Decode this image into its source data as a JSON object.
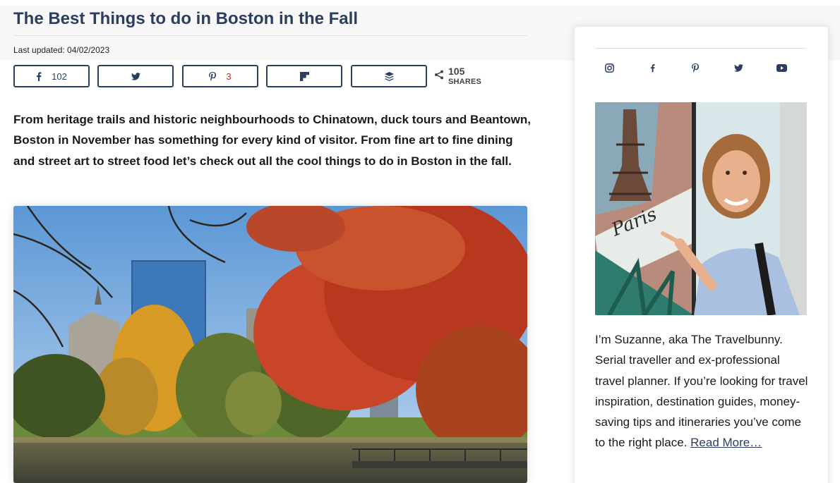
{
  "article": {
    "title": "The Best Things to do in Boston in the Fall",
    "last_updated": "Last updated: 04/02/2023",
    "intro": "From heritage trails and historic neighbourhoods to Chinatown, duck tours and Beantown, Boston in November has something for every kind of visitor. From fine art to fine dining and street art to street food let’s check out all the cool things to do in Boston in the fall."
  },
  "share": {
    "buttons": [
      {
        "icon": "facebook-icon",
        "count": "102"
      },
      {
        "icon": "twitter-icon",
        "count": ""
      },
      {
        "icon": "pinterest-icon",
        "count": "3"
      },
      {
        "icon": "flipboard-icon",
        "count": ""
      },
      {
        "icon": "buffer-icon",
        "count": ""
      }
    ],
    "total": "105",
    "total_label": "SHARES"
  },
  "sidebar": {
    "social_icons": [
      "instagram-icon",
      "facebook-icon",
      "pinterest-icon",
      "twitter-icon",
      "youtube-icon"
    ],
    "portrait_sign": "Paris",
    "bio": "I’m Suzanne, aka The Travelbunny. Serial traveller and ex-professional travel planner. If you’re looking for travel inspiration, destination guides, money-saving tips and itineraries you’ve come to the right place.",
    "read_more": "Read More…"
  },
  "colors": {
    "brand": "#2a3f5f",
    "share_red": "#b5351d"
  }
}
